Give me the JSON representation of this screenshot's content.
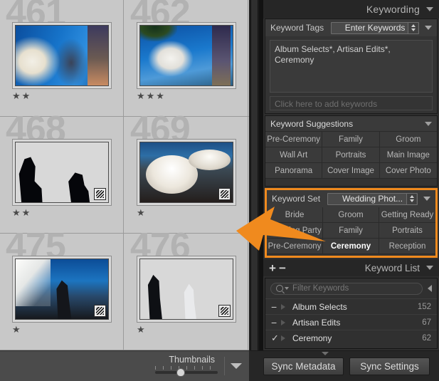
{
  "grid": {
    "cells": [
      {
        "index": "461",
        "stars": "★★",
        "rating": 2,
        "photo": "ph461",
        "badge": "keyword-badge"
      },
      {
        "index": "462",
        "stars": "★★★",
        "rating": 3,
        "photo": "ph462",
        "badge": "keyword-badge"
      },
      {
        "index": "468",
        "stars": "★★",
        "rating": 2,
        "photo": "ph468",
        "badge": "keyword-badge"
      },
      {
        "index": "469",
        "stars": "★",
        "rating": 1,
        "photo": "ph469",
        "badge": "keyword-badge"
      },
      {
        "index": "475",
        "stars": "★",
        "rating": 1,
        "photo": "ph475",
        "badge": "keyword-badge"
      },
      {
        "index": "476",
        "stars": "★",
        "rating": 1,
        "photo": "ph476",
        "badge": "keyword-badge"
      }
    ]
  },
  "keywording": {
    "header_title": "Keywording",
    "tags_label": "Keyword Tags",
    "tags_mode": "Enter Keywords",
    "tags_value": "Album Selects*, Artisan Edits*, Ceremony",
    "add_placeholder": "Click here to add keywords"
  },
  "suggestions": {
    "title": "Keyword Suggestions",
    "items": [
      "Pre-Ceremony",
      "Family",
      "Groom",
      "Wall Art",
      "Portraits",
      "Main Image",
      "Panorama",
      "Cover Image",
      "Cover Photo"
    ]
  },
  "keyword_set": {
    "label": "Keyword Set",
    "value": "Wedding Phot...",
    "items": [
      "Bride",
      "Groom",
      "Getting Ready",
      "Wedding Party",
      "Family",
      "Portraits",
      "Pre-Ceremony",
      "Ceremony",
      "Reception"
    ],
    "active": "Ceremony",
    "highlight_color": "#f08a1e"
  },
  "keyword_list": {
    "title": "Keyword List",
    "add_label": "+",
    "remove_label": "−",
    "filter_placeholder": "Filter Keywords",
    "rows": [
      {
        "mark": "−",
        "name": "Album Selects",
        "count": "152"
      },
      {
        "mark": "−",
        "name": "Artisan Edits",
        "count": "67"
      },
      {
        "mark": "✓",
        "name": "Ceremony",
        "count": "62"
      }
    ]
  },
  "toolbar": {
    "thumbnails_label": "Thumbnails"
  },
  "sync": {
    "metadata_label": "Sync Metadata",
    "settings_label": "Sync Settings"
  }
}
